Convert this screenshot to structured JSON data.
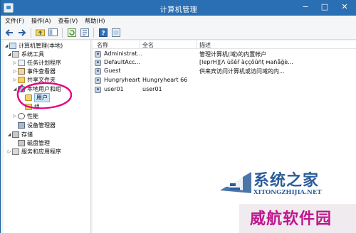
{
  "window": {
    "title": "计算机管理",
    "controls": {
      "minimize": "−",
      "maximize": "□",
      "close": "✕"
    }
  },
  "menu": [
    "文件(F)",
    "操作(A)",
    "查看(V)",
    "帮助(H)"
  ],
  "toolbar": {
    "icons": [
      "back-arrow-icon",
      "forward-arrow-icon",
      "up-folder-icon",
      "show-tree-icon",
      "refresh-icon",
      "export-icon",
      "help-icon",
      "properties-icon"
    ]
  },
  "tree": {
    "root": "计算机管理(本地)",
    "system_tools": "系统工具",
    "task_scheduler": "任务计划程序",
    "event_viewer": "事件查看器",
    "shared_folders": "共享文件夹",
    "local_users_groups": "本地用户和组",
    "users": "用户",
    "groups": "组",
    "performance": "性能",
    "device_manager": "设备管理器",
    "storage": "存储",
    "disk_management": "磁盘管理",
    "services_apps": "服务和应用程序"
  },
  "list": {
    "columns": [
      "名称",
      "全名",
      "描述"
    ],
    "rows": [
      {
        "name": "Administrat...",
        "fullname": "",
        "desc": "管理计算机(域)的内置帐户"
      },
      {
        "name": "DefaultAcc...",
        "fullname": "",
        "desc": "[leprH][Λ ùšêř àççôûñţ мañåğè..."
      },
      {
        "name": "Guest",
        "fullname": "",
        "desc": "供来宾访问计算机或访问域的内..."
      },
      {
        "name": "Hungryheart",
        "fullname": "Hungryheart 66",
        "desc": ""
      },
      {
        "name": "user01",
        "fullname": "user01",
        "desc": ""
      }
    ]
  },
  "watermark": {
    "site_name": "系统之家",
    "site_url": "XITONGZHIJIA.NET",
    "corner_text": "威航软件园"
  },
  "colors": {
    "titlebar": "#2a6fb3",
    "annotation": "#e6007e",
    "watermark_blue": "#2a5d9a",
    "watermark_magenta": "#c0178d"
  }
}
